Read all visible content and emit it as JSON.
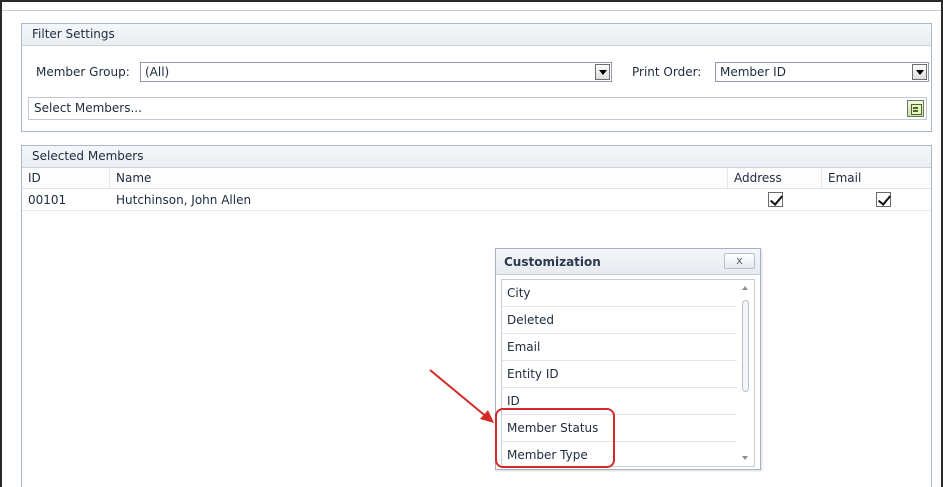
{
  "filter_settings": {
    "title": "Filter Settings",
    "member_group_label": "Member Group:",
    "member_group_value": "(All)",
    "print_order_label": "Print Order:",
    "print_order_value": "Member ID",
    "select_members_placeholder": "Select Members..."
  },
  "selected_members": {
    "title": "Selected Members",
    "columns": [
      "ID",
      "Name",
      "Address",
      "Email"
    ],
    "rows": [
      {
        "id": "00101",
        "name": "Hutchinson, John Allen",
        "address": true,
        "email": true
      }
    ]
  },
  "customization": {
    "title": "Customization",
    "close_label": "x",
    "fields": [
      "City",
      "Deleted",
      "Email",
      "Entity ID",
      "ID",
      "Member Status",
      "Member Type"
    ]
  },
  "annotation": {
    "color": "#d42a2a",
    "highlighted_fields": [
      "Member Status",
      "Member Type"
    ]
  }
}
